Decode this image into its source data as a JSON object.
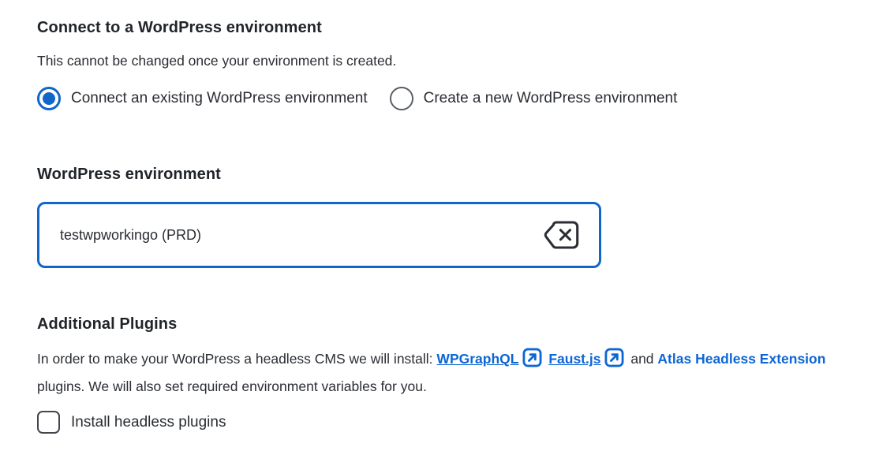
{
  "colors": {
    "accent_blue": "#1265C9",
    "link_blue": "#0D66D5",
    "heading_text": "#212429",
    "body_text": "#2A2D33",
    "control_border": "#42464D"
  },
  "connect_section": {
    "title": "Connect to a WordPress environment",
    "subtitle": "This cannot be changed once your environment is created.",
    "radio_options": [
      {
        "label": "Connect an existing WordPress environment",
        "selected": true
      },
      {
        "label": "Create a new WordPress environment",
        "selected": false
      }
    ]
  },
  "environment_section": {
    "label": "WordPress environment",
    "selected_value": "testwpworkingo (PRD)",
    "clear_icon": "backspace-clear-icon"
  },
  "plugins_section": {
    "title": "Additional Plugins",
    "intro_text": "In order to make your WordPress a headless CMS we will install:",
    "links": [
      {
        "label": "WPGraphQL",
        "external": true
      },
      {
        "label": "Faust.js",
        "external": true
      },
      {
        "label": "Atlas Headless Extension",
        "external": false
      }
    ],
    "conjunction": "and",
    "outro_text": "plugins. We will also set required environment variables for you.",
    "checkbox": {
      "label": "Install headless plugins",
      "checked": false
    }
  }
}
